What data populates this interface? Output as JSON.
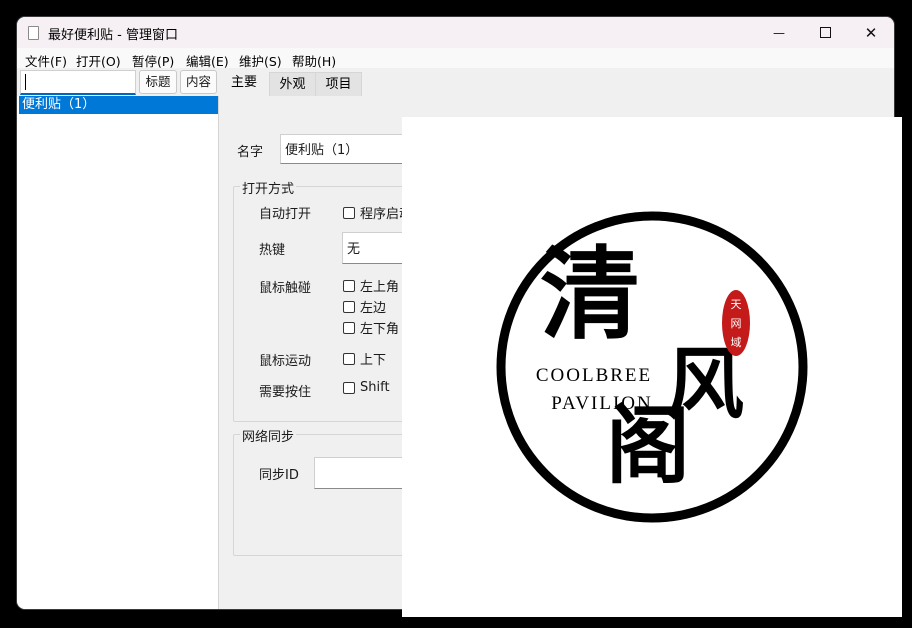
{
  "window": {
    "title": "最好便利贴 - 管理窗口",
    "caption": {
      "minimize": "—",
      "close": "✕"
    }
  },
  "menu": [
    "文件(F)",
    "打开(O)",
    "暂停(P)",
    "编辑(E)",
    "维护(S)",
    "帮助(H)"
  ],
  "toolbar": {
    "search_value": "",
    "title_button": "标题",
    "content_button": "内容"
  },
  "tabs": [
    {
      "label": "主要",
      "active": true
    },
    {
      "label": "外观",
      "active": false
    },
    {
      "label": "项目",
      "active": false
    }
  ],
  "sidebar": {
    "items": [
      {
        "label": "便利贴（1）",
        "selected": true
      }
    ]
  },
  "form": {
    "name_label": "名字",
    "name_value": "便利贴（1）",
    "open_group": {
      "title": "打开方式",
      "auto_open_label": "自动打开",
      "auto_open_option": "程序启动",
      "hotkey_label": "热键",
      "hotkey_value": "无",
      "mouse_touch_label": "鼠标触碰",
      "mouse_touch_options": [
        "左上角",
        "左边",
        "左下角"
      ],
      "mouse_move_label": "鼠标运动",
      "mouse_move_option": "上下",
      "require_press_label": "需要按住",
      "require_press_option": "Shift"
    },
    "sync_group": {
      "title": "网络同步",
      "sync_id_label": "同步ID",
      "sync_id_value": ""
    }
  },
  "logo": {
    "char_1": "清",
    "char_2": "风",
    "char_3": "阁",
    "english_1": "COOLBREE",
    "english_2": "PAVILION",
    "seal_chars": [
      "天",
      "网",
      "域"
    ],
    "seal_color": "#c41a1a"
  }
}
